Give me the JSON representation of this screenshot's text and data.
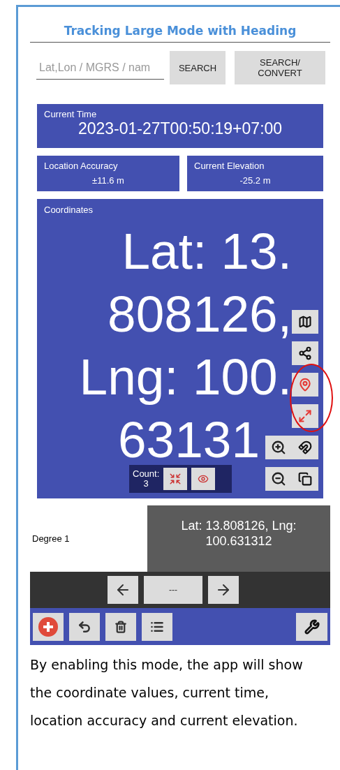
{
  "document": {
    "title": "Tracking Large Mode with Heading",
    "paragraph": "By enabling this mode, the app will show the coordinate values, current time, location accuracy and current elevation."
  },
  "search": {
    "placeholder": "Lat,Lon / MGRS / nam",
    "buttons": [
      "SEARCH",
      "SEARCH/\nCONVERT"
    ]
  },
  "current_time": {
    "label": "Current Time",
    "value": "2023-01-27T00:50:19+07:00"
  },
  "info_cards": [
    {
      "label": "Location Accuracy",
      "value": "±11.6 m"
    },
    {
      "label": "Current Elevation",
      "value": "-25.2 m"
    }
  ],
  "coordinates": {
    "label": "Coordinates",
    "lines": [
      "Lat: 13.",
      "808126,",
      "Lng: 100.",
      "63131"
    ]
  },
  "count": {
    "label": "Count:",
    "value": "3"
  },
  "degree_label": "Degree 1",
  "readout": "Lat: 13.808126, Lng:\n100.631312",
  "nav": {
    "center": "---"
  }
}
